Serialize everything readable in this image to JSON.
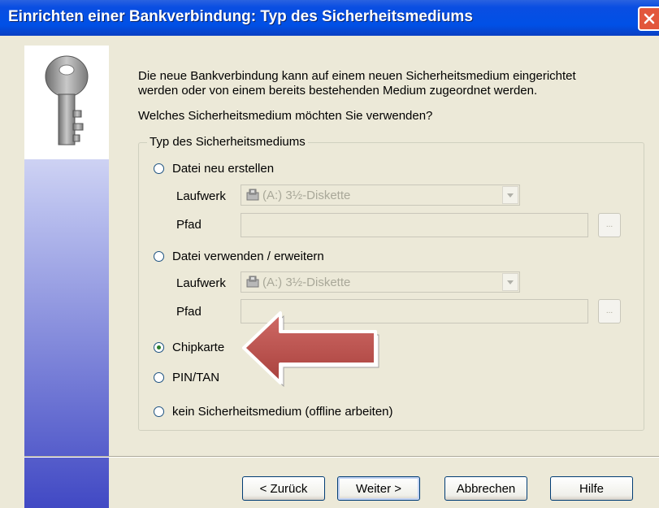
{
  "window": {
    "title": "Einrichten einer Bankverbindung: Typ des Sicherheitsmediums"
  },
  "intro": {
    "line1": "Die neue Bankverbindung kann  auf einem neuen Sicherheitsmedium eingerichtet",
    "line2": "werden oder von einem bereits bestehenden Medium zugeordnet werden.",
    "question": "Welches Sicherheitsmedium möchten Sie verwenden?"
  },
  "group": {
    "legend": "Typ des Sicherheitsmediums",
    "options": [
      {
        "label": "Datei neu erstellen",
        "checked": false
      },
      {
        "label": "Datei verwenden / erweitern",
        "checked": false
      },
      {
        "label": "Chipkarte",
        "checked": true
      },
      {
        "label": "PIN/TAN",
        "checked": false
      },
      {
        "label": "kein Sicherheitsmedium (offline arbeiten)",
        "checked": false
      }
    ],
    "new_file": {
      "drive_label": "Laufwerk",
      "drive_value": "(A:) 3½-Diskette",
      "path_label": "Pfad",
      "path_value": "",
      "browse_label": "..."
    },
    "existing_file": {
      "drive_label": "Laufwerk",
      "drive_value": "(A:) 3½-Diskette",
      "path_label": "Pfad",
      "path_value": "",
      "browse_label": "..."
    }
  },
  "buttons": {
    "back": "< Zurück",
    "next": "Weiter >",
    "cancel": "Abbrechen",
    "help": "Hilfe"
  },
  "icons": {
    "key": "key-icon",
    "drive": "floppy-drive-icon",
    "close": "close-icon",
    "annotation": "red-arrow-annotation"
  },
  "colors": {
    "titlebar": "#0050e6",
    "close": "#e2573c",
    "arrow": "#c0504d",
    "dialog_bg": "#ece9d8"
  }
}
